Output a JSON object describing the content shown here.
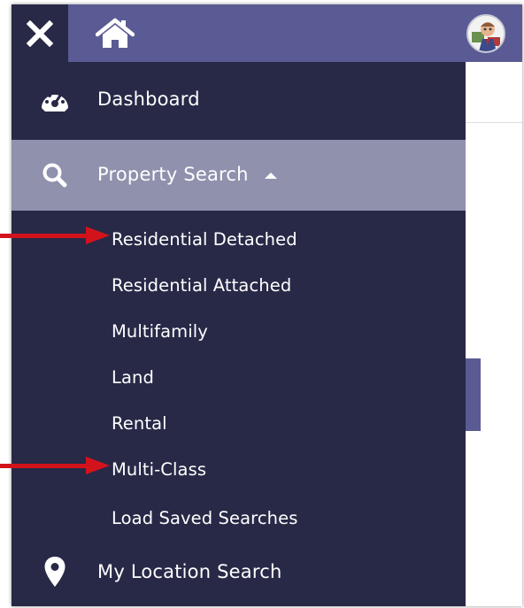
{
  "topbar": {
    "close_icon": "close-icon",
    "home_icon": "home-icon",
    "avatar_icon": "user-avatar"
  },
  "sidebar": {
    "dashboard": {
      "label": "Dashboard",
      "icon": "dashboard-gauge-icon"
    },
    "property_search": {
      "label": "Property Search",
      "icon": "search-icon",
      "expanded": true,
      "sub_items": [
        "Residential Detached",
        "Residential Attached",
        "Multifamily",
        "Land",
        "Rental",
        "Multi-Class",
        "Load Saved Searches"
      ]
    },
    "my_location_search": {
      "label": "My Location Search",
      "icon": "map-pin-icon"
    }
  },
  "annotations": {
    "arrow_color": "#d3131b",
    "arrow_targets": [
      "Residential Detached",
      "Multi-Class"
    ]
  },
  "colors": {
    "topbar": "#5a5b94",
    "sidebar": "#282947",
    "active_item": "#8f91ad",
    "text": "#ffffff"
  }
}
